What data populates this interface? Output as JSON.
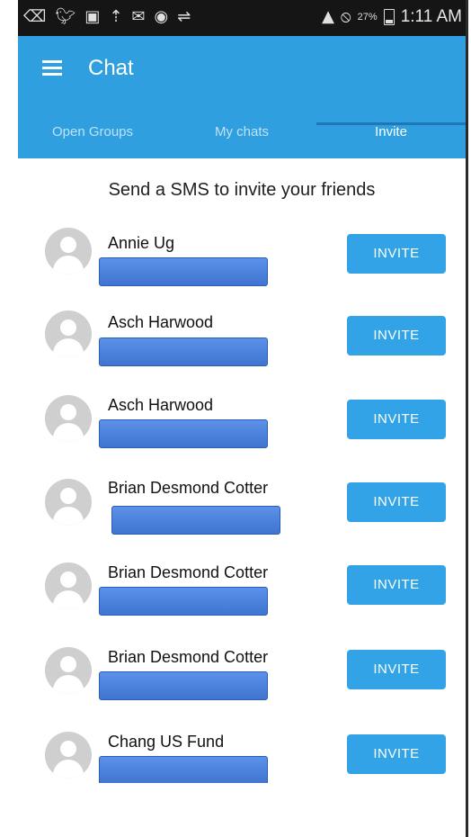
{
  "status_bar": {
    "left_icons": [
      "back-icon",
      "twitter-icon",
      "image-icon",
      "upload-icon",
      "chat-icon",
      "wifi-icon",
      "usb-icon",
      "mute-icon"
    ],
    "battery_percent": "27%",
    "time": "1:11 AM"
  },
  "app_bar": {
    "title": "Chat",
    "color": "#2f9fe0"
  },
  "tabs": [
    {
      "label": "Open Groups",
      "active": false
    },
    {
      "label": "My chats",
      "active": false
    },
    {
      "label": "Invite",
      "active": true
    }
  ],
  "invite_header": "Send a SMS to invite your friends",
  "contacts": [
    {
      "name": "Annie Ug",
      "button": "INVITE"
    },
    {
      "name": "Asch Harwood",
      "button": "INVITE"
    },
    {
      "name": "Asch Harwood",
      "button": "INVITE"
    },
    {
      "name": "Brian Desmond Cotter",
      "button": "INVITE"
    },
    {
      "name": "Brian Desmond Cotter",
      "button": "INVITE"
    },
    {
      "name": "Brian Desmond Cotter",
      "button": "INVITE"
    },
    {
      "name": "Chang US Fund",
      "button": "INVITE"
    }
  ],
  "colors": {
    "accent": "#2f9fe0",
    "button": "#31a3e6",
    "redaction": "#4a80dc"
  }
}
